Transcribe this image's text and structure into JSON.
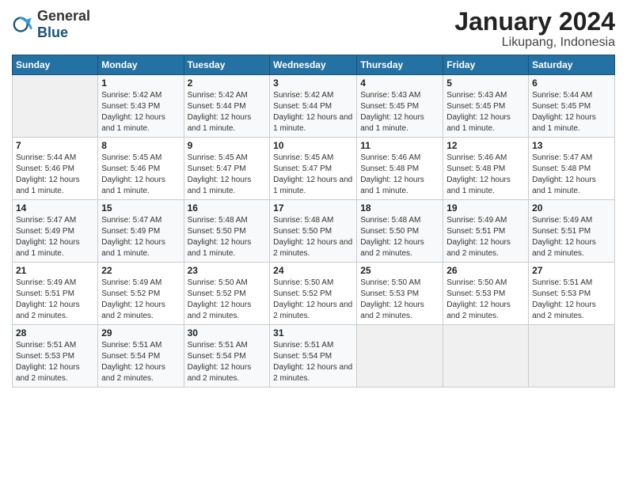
{
  "header": {
    "logo_general": "General",
    "logo_blue": "Blue",
    "month_title": "January 2024",
    "location": "Likupang, Indonesia"
  },
  "columns": [
    "Sunday",
    "Monday",
    "Tuesday",
    "Wednesday",
    "Thursday",
    "Friday",
    "Saturday"
  ],
  "weeks": [
    [
      {
        "day": "",
        "sunrise": "",
        "sunset": "",
        "daylight": "",
        "empty": true
      },
      {
        "day": "1",
        "sunrise": "Sunrise: 5:42 AM",
        "sunset": "Sunset: 5:43 PM",
        "daylight": "Daylight: 12 hours and 1 minute."
      },
      {
        "day": "2",
        "sunrise": "Sunrise: 5:42 AM",
        "sunset": "Sunset: 5:44 PM",
        "daylight": "Daylight: 12 hours and 1 minute."
      },
      {
        "day": "3",
        "sunrise": "Sunrise: 5:42 AM",
        "sunset": "Sunset: 5:44 PM",
        "daylight": "Daylight: 12 hours and 1 minute."
      },
      {
        "day": "4",
        "sunrise": "Sunrise: 5:43 AM",
        "sunset": "Sunset: 5:45 PM",
        "daylight": "Daylight: 12 hours and 1 minute."
      },
      {
        "day": "5",
        "sunrise": "Sunrise: 5:43 AM",
        "sunset": "Sunset: 5:45 PM",
        "daylight": "Daylight: 12 hours and 1 minute."
      },
      {
        "day": "6",
        "sunrise": "Sunrise: 5:44 AM",
        "sunset": "Sunset: 5:45 PM",
        "daylight": "Daylight: 12 hours and 1 minute."
      }
    ],
    [
      {
        "day": "7",
        "sunrise": "Sunrise: 5:44 AM",
        "sunset": "Sunset: 5:46 PM",
        "daylight": "Daylight: 12 hours and 1 minute."
      },
      {
        "day": "8",
        "sunrise": "Sunrise: 5:45 AM",
        "sunset": "Sunset: 5:46 PM",
        "daylight": "Daylight: 12 hours and 1 minute."
      },
      {
        "day": "9",
        "sunrise": "Sunrise: 5:45 AM",
        "sunset": "Sunset: 5:47 PM",
        "daylight": "Daylight: 12 hours and 1 minute."
      },
      {
        "day": "10",
        "sunrise": "Sunrise: 5:45 AM",
        "sunset": "Sunset: 5:47 PM",
        "daylight": "Daylight: 12 hours and 1 minute."
      },
      {
        "day": "11",
        "sunrise": "Sunrise: 5:46 AM",
        "sunset": "Sunset: 5:48 PM",
        "daylight": "Daylight: 12 hours and 1 minute."
      },
      {
        "day": "12",
        "sunrise": "Sunrise: 5:46 AM",
        "sunset": "Sunset: 5:48 PM",
        "daylight": "Daylight: 12 hours and 1 minute."
      },
      {
        "day": "13",
        "sunrise": "Sunrise: 5:47 AM",
        "sunset": "Sunset: 5:48 PM",
        "daylight": "Daylight: 12 hours and 1 minute."
      }
    ],
    [
      {
        "day": "14",
        "sunrise": "Sunrise: 5:47 AM",
        "sunset": "Sunset: 5:49 PM",
        "daylight": "Daylight: 12 hours and 1 minute."
      },
      {
        "day": "15",
        "sunrise": "Sunrise: 5:47 AM",
        "sunset": "Sunset: 5:49 PM",
        "daylight": "Daylight: 12 hours and 1 minute."
      },
      {
        "day": "16",
        "sunrise": "Sunrise: 5:48 AM",
        "sunset": "Sunset: 5:50 PM",
        "daylight": "Daylight: 12 hours and 1 minute."
      },
      {
        "day": "17",
        "sunrise": "Sunrise: 5:48 AM",
        "sunset": "Sunset: 5:50 PM",
        "daylight": "Daylight: 12 hours and 2 minutes."
      },
      {
        "day": "18",
        "sunrise": "Sunrise: 5:48 AM",
        "sunset": "Sunset: 5:50 PM",
        "daylight": "Daylight: 12 hours and 2 minutes."
      },
      {
        "day": "19",
        "sunrise": "Sunrise: 5:49 AM",
        "sunset": "Sunset: 5:51 PM",
        "daylight": "Daylight: 12 hours and 2 minutes."
      },
      {
        "day": "20",
        "sunrise": "Sunrise: 5:49 AM",
        "sunset": "Sunset: 5:51 PM",
        "daylight": "Daylight: 12 hours and 2 minutes."
      }
    ],
    [
      {
        "day": "21",
        "sunrise": "Sunrise: 5:49 AM",
        "sunset": "Sunset: 5:51 PM",
        "daylight": "Daylight: 12 hours and 2 minutes."
      },
      {
        "day": "22",
        "sunrise": "Sunrise: 5:49 AM",
        "sunset": "Sunset: 5:52 PM",
        "daylight": "Daylight: 12 hours and 2 minutes."
      },
      {
        "day": "23",
        "sunrise": "Sunrise: 5:50 AM",
        "sunset": "Sunset: 5:52 PM",
        "daylight": "Daylight: 12 hours and 2 minutes."
      },
      {
        "day": "24",
        "sunrise": "Sunrise: 5:50 AM",
        "sunset": "Sunset: 5:52 PM",
        "daylight": "Daylight: 12 hours and 2 minutes."
      },
      {
        "day": "25",
        "sunrise": "Sunrise: 5:50 AM",
        "sunset": "Sunset: 5:53 PM",
        "daylight": "Daylight: 12 hours and 2 minutes."
      },
      {
        "day": "26",
        "sunrise": "Sunrise: 5:50 AM",
        "sunset": "Sunset: 5:53 PM",
        "daylight": "Daylight: 12 hours and 2 minutes."
      },
      {
        "day": "27",
        "sunrise": "Sunrise: 5:51 AM",
        "sunset": "Sunset: 5:53 PM",
        "daylight": "Daylight: 12 hours and 2 minutes."
      }
    ],
    [
      {
        "day": "28",
        "sunrise": "Sunrise: 5:51 AM",
        "sunset": "Sunset: 5:53 PM",
        "daylight": "Daylight: 12 hours and 2 minutes."
      },
      {
        "day": "29",
        "sunrise": "Sunrise: 5:51 AM",
        "sunset": "Sunset: 5:54 PM",
        "daylight": "Daylight: 12 hours and 2 minutes."
      },
      {
        "day": "30",
        "sunrise": "Sunrise: 5:51 AM",
        "sunset": "Sunset: 5:54 PM",
        "daylight": "Daylight: 12 hours and 2 minutes."
      },
      {
        "day": "31",
        "sunrise": "Sunrise: 5:51 AM",
        "sunset": "Sunset: 5:54 PM",
        "daylight": "Daylight: 12 hours and 2 minutes."
      },
      {
        "day": "",
        "sunrise": "",
        "sunset": "",
        "daylight": "",
        "empty": true
      },
      {
        "day": "",
        "sunrise": "",
        "sunset": "",
        "daylight": "",
        "empty": true
      },
      {
        "day": "",
        "sunrise": "",
        "sunset": "",
        "daylight": "",
        "empty": true
      }
    ]
  ]
}
